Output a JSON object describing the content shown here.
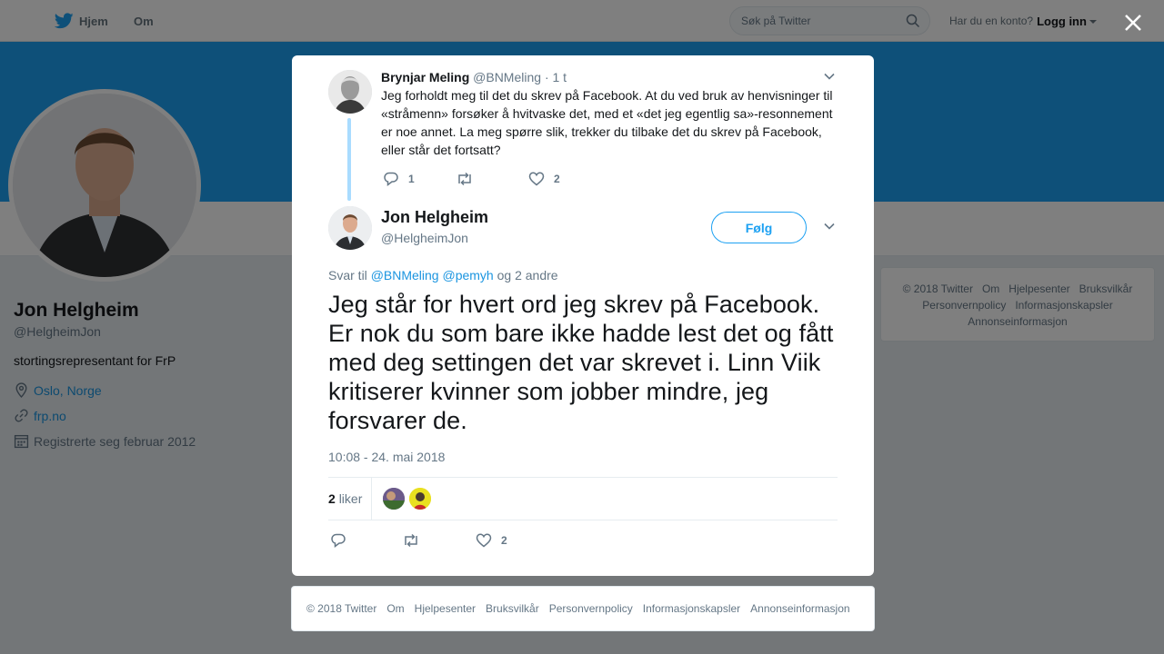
{
  "topnav": {
    "home_label": "Hjem",
    "about_label": "Om",
    "search_placeholder": "Søk på Twitter",
    "account_prompt": "Har du en konto?",
    "login_label": "Logg inn"
  },
  "profile": {
    "name": "Jon Helgheim",
    "handle": "@HelgheimJon",
    "bio": "stortingsrepresentant for FrP",
    "location": "Oslo, Norge",
    "url": "frp.no",
    "joined": "Registrerte seg februar 2012"
  },
  "sidebar_footer": {
    "items": [
      "© 2018 Twitter",
      "Om",
      "Hjelpesenter",
      "Bruksvilkår",
      "Personvernpolicy",
      "Informasjonskapsler",
      "Annonseinformasjon"
    ]
  },
  "parent_tweet": {
    "name": "Brynjar Meling",
    "handle": "@BNMeling",
    "time": "· 1 t",
    "text": "Jeg forholdt meg til det du skrev på Facebook. At du ved bruk av henvisninger til «stråmenn» forsøker å hvitvaske det, med et «det jeg egentlig sa»-resonnement er noe annet. La meg spørre slik, trekker du tilbake det du skrev på Facebook, eller står det fortsatt?",
    "reply_count": "1",
    "like_count": "2"
  },
  "main_tweet": {
    "name": "Jon Helgheim",
    "handle": "@HelgheimJon",
    "follow_label": "Følg",
    "reply_prefix": "Svar til",
    "reply_mention_1": "@BNMeling",
    "reply_mention_2": "@pemyh",
    "reply_suffix": "og 2 andre",
    "text": "Jeg står for hvert ord jeg skrev på Facebook. Er nok du som bare ikke hadde lest det og fått med deg settingen det var skrevet i. Linn Viik kritiserer kvinner som jobber mindre, jeg forsvarer de.",
    "date": "10:08 - 24. mai 2018",
    "likes_number": "2",
    "likes_word": "liker",
    "like_count": "2"
  },
  "modal_footer": {
    "items": [
      "© 2018 Twitter",
      "Om",
      "Hjelpesenter",
      "Bruksvilkår",
      "Personvernpolicy",
      "Informasjonskapsler",
      "Annonseinformasjon"
    ]
  },
  "colors": {
    "brand": "#1da1f2",
    "link": "#1b95e0",
    "muted": "#657786",
    "thread_line": "#a9dcff"
  }
}
